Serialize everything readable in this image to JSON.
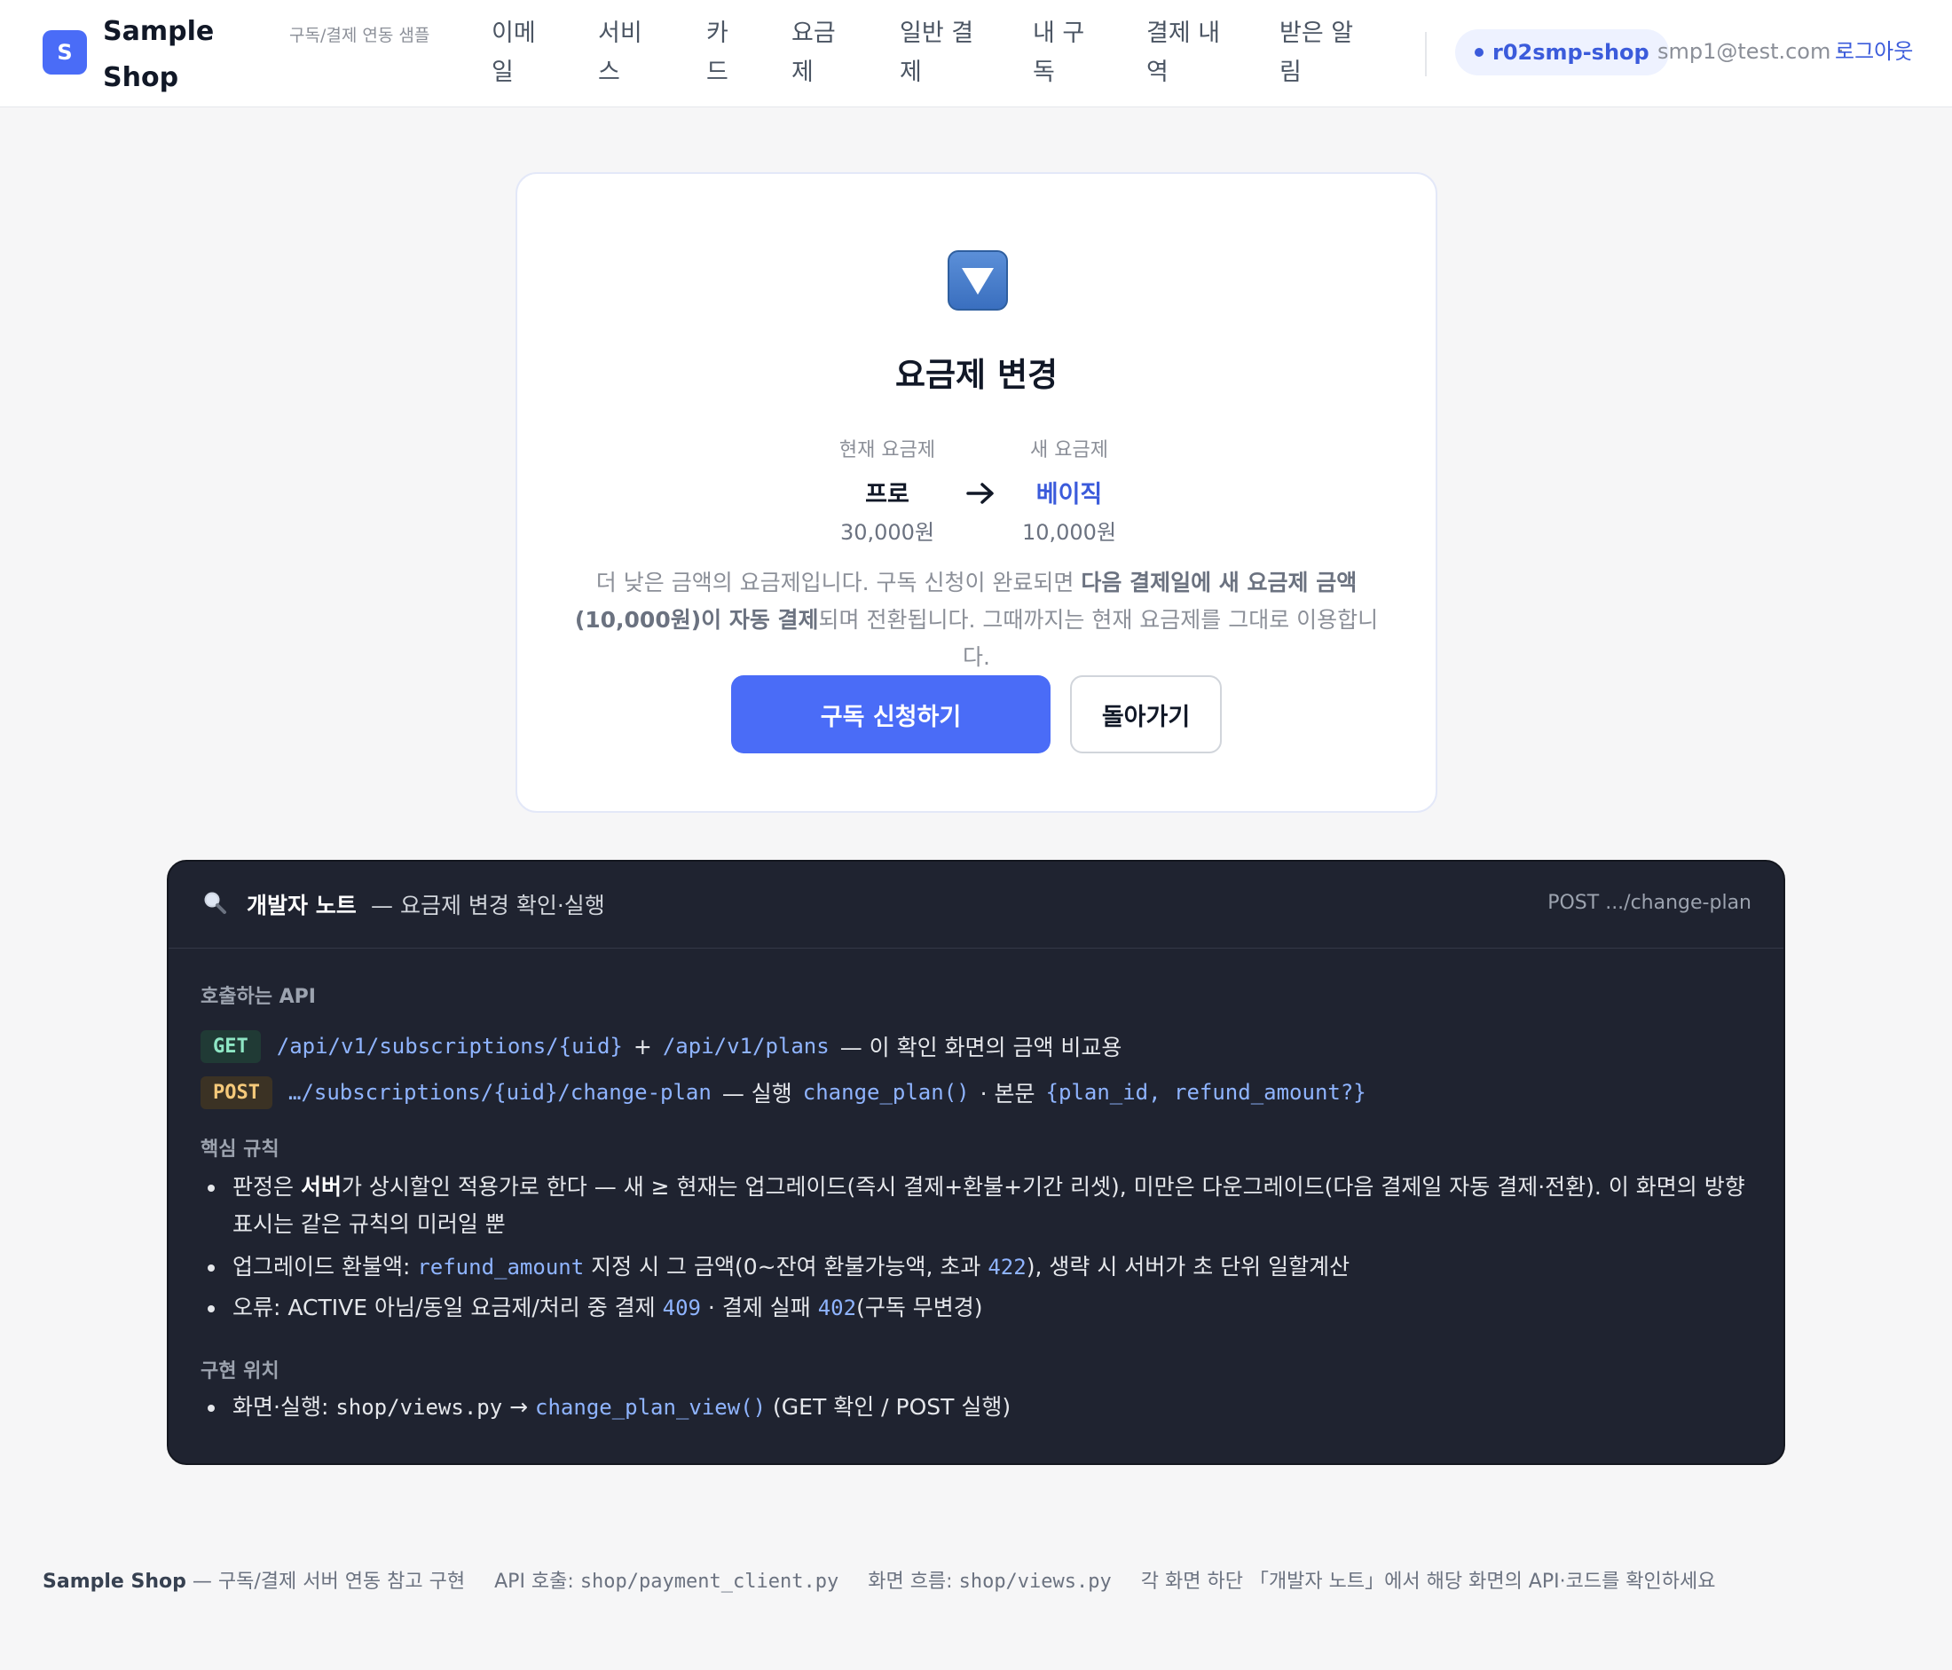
{
  "header": {
    "logo_letter": "S",
    "brand": "Sample Shop",
    "tagline": "구독/결제 연동 샘플",
    "nav": [
      "이메일",
      "서비스",
      "카드",
      "요금제",
      "일반 결제",
      "내 구독",
      "결제 내역",
      "받은 알림"
    ],
    "shop_badge": "r02smp-shop",
    "email": "smp1@test.com ·",
    "logout": "로그아웃"
  },
  "card": {
    "icon": "down-triangle-icon",
    "title": "요금제 변경",
    "current": {
      "label": "현재 요금제",
      "name": "프로",
      "price": "30,000원"
    },
    "next": {
      "label": "새 요금제",
      "name": "베이직",
      "price": "10,000원"
    },
    "desc_pre": "더 낮은 금액의 요금제입니다. 구독 신청이 완료되면 ",
    "desc_bold": "다음 결제일에 새 요금제 금액(10,000원)이 자동 결제",
    "desc_post": "되며 전환됩니다. 그때까지는 현재 요금제를 그대로 이용합니다.",
    "primary_btn": "구독 신청하기",
    "secondary_btn": "돌아가기"
  },
  "dev": {
    "title": "개발자 노트",
    "subtitle": "— 요금제 변경 확인·실행",
    "endpoint": "POST .../change-plan",
    "api_label": "호출하는 API",
    "get": {
      "method": "GET",
      "path1": "/api/v1/subscriptions/{uid}",
      "plus": "+",
      "path2": "/api/v1/plans",
      "note": "— 이 확인 화면의 금액 비교용"
    },
    "post": {
      "method": "POST",
      "path": "…/subscriptions/{uid}/change-plan",
      "note1": "— 실행",
      "fn": "change_plan()",
      "note2": "· 본문",
      "body": "{plan_id, refund_amount?}"
    },
    "rules_label": "핵심 규칙",
    "rule1_pre": "판정은 ",
    "rule1_bold": "서버",
    "rule1_post": "가 상시할인 적용가로 한다 — 새 ≥ 현재는 업그레이드(즉시 결제+환불+기간 리셋), 미만은 다운그레이드(다음 결제일 자동 결제·전환). 이 화면의 방향 표시는 같은 규칙의 미러일 뿐",
    "rule2_pre": "업그레이드 환불액: ",
    "rule2_code": "refund_amount",
    "rule2_mid": " 지정 시 그 금액(0~잔여 환불가능액, 초과 ",
    "rule2_code2": "422",
    "rule2_post": "), 생략 시 서버가 초 단위 일할계산",
    "rule3_pre": "오류: ACTIVE 아님/동일 요금제/처리 중 결제 ",
    "rule3_code": "409",
    "rule3_mid": " · 결제 실패 ",
    "rule3_code2": "402",
    "rule3_post": "(구독 무변경)",
    "impl_label": "구현 위치",
    "impl_pre": "화면·실행: ",
    "impl_file": "shop/views.py",
    "impl_arrow": " → ",
    "impl_fn": "change_plan_view()",
    "impl_post": " (GET 확인 / POST 실행)"
  },
  "footer": {
    "brand": "Sample Shop",
    "desc": "— 구독/결제 서버 연동 참고 구현",
    "api_label": "API 호출: ",
    "api_file": "shop/payment_client.py",
    "flow_label": "화면 흐름: ",
    "flow_file": "shop/views.py",
    "hint": "각 화면 하단 「개발자 노트」에서 해당 화면의 API·코드를 확인하세요"
  },
  "colors": {
    "accent": "#4a6cf7",
    "new_plan": "#3b5bdb",
    "dev_bg": "#1f2330"
  }
}
